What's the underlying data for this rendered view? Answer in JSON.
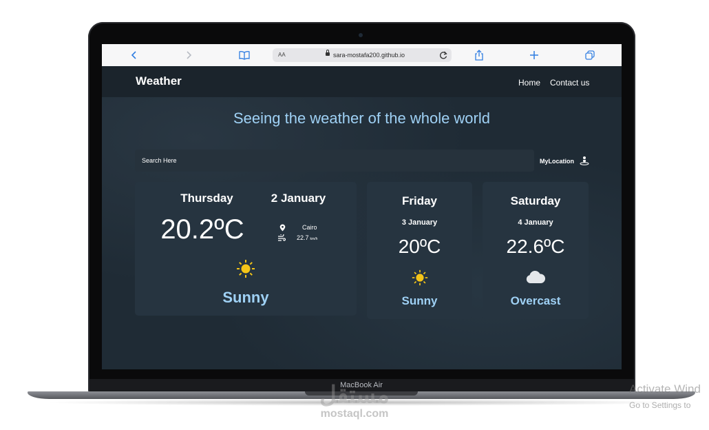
{
  "browser": {
    "text_size_label": "AA",
    "url": "sara-mostafa200.github.io"
  },
  "site": {
    "brand": "Weather",
    "nav": [
      "Home",
      "Contact us"
    ],
    "hero_title": "Seeing the weather of the whole world",
    "search_placeholder": "Search Here",
    "location_label": "MyLocation"
  },
  "forecast": {
    "today": {
      "day": "Thursday",
      "date": "2 January",
      "temp": "20.2ºC",
      "city": "Cairo",
      "wind": "22.7",
      "wind_unit": "km/h",
      "condition": "Sunny",
      "icon": "sun-icon"
    },
    "next": [
      {
        "day": "Friday",
        "date": "3 January",
        "temp": "20ºC",
        "condition": "Sunny",
        "icon": "sun-icon"
      },
      {
        "day": "Saturday",
        "date": "4 January",
        "temp": "22.6ºC",
        "condition": "Overcast",
        "icon": "cloud-icon"
      }
    ]
  },
  "device": {
    "model": "MacBook Air"
  },
  "watermarks": {
    "brand_arabic": "مستقل",
    "domain": "mostaql.com",
    "activate_title": "Activate Wind",
    "activate_sub": "Go to Settings to"
  },
  "colors": {
    "page_bg": "#1f2b35",
    "card_bg": "#263440",
    "accent": "#9fd1f5",
    "sun": "#f5c518",
    "browser_blue": "#2f7de1"
  }
}
